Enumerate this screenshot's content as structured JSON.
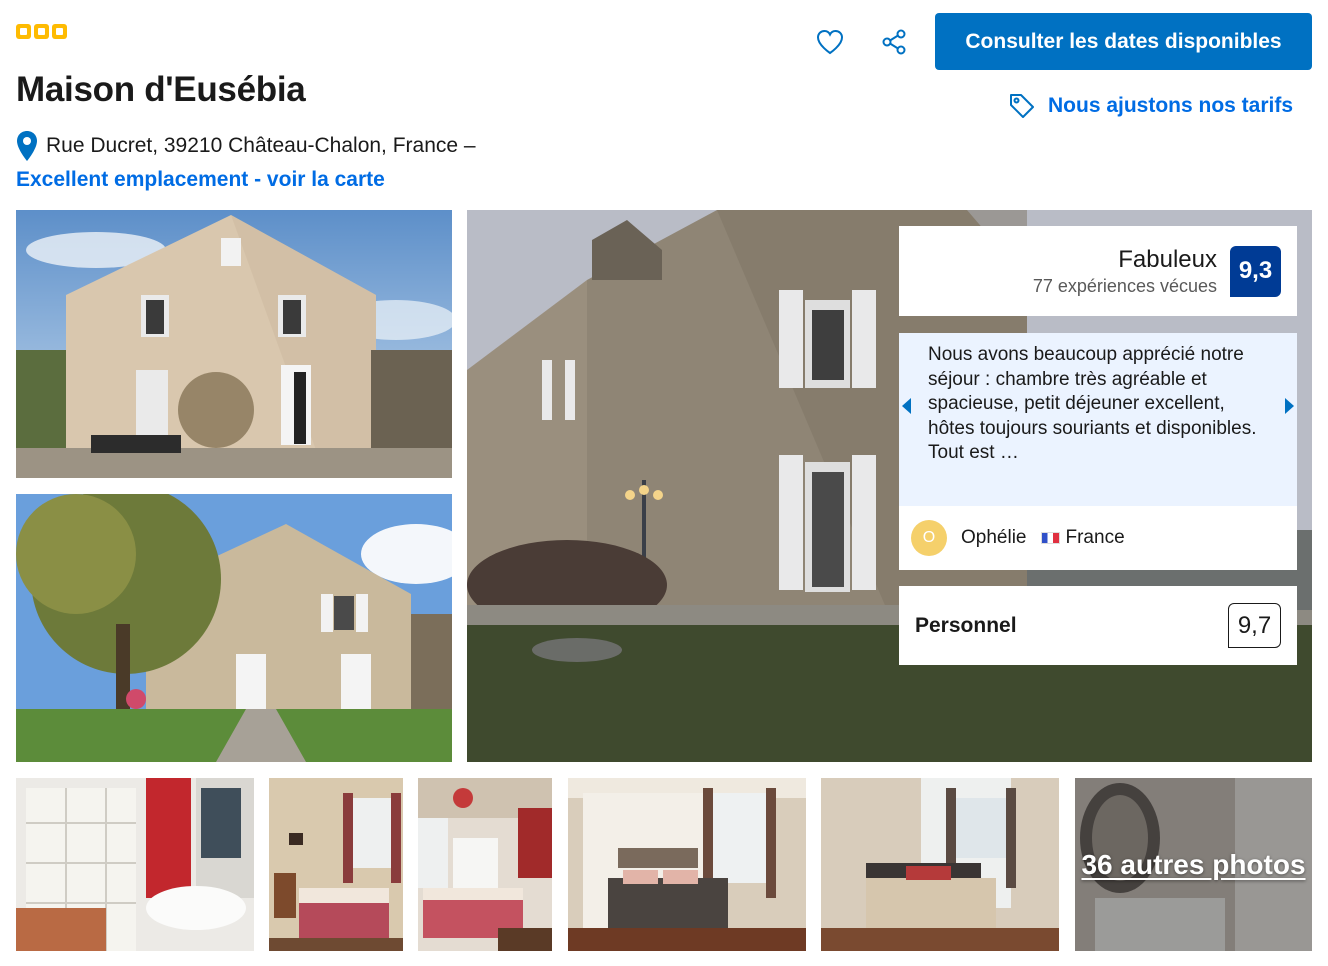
{
  "property": {
    "star_rating": 3,
    "name": "Maison d'Eusébia",
    "address": "Rue Ducret, 39210 Château-Chalon, France –",
    "map_link": "Excellent emplacement - voir la carte"
  },
  "header": {
    "cta_label": "Consulter les dates disponibles",
    "price_match_label": "Nous ajustons nos tarifs"
  },
  "rating": {
    "label": "Fabuleux",
    "reviews_count": "77 expériences vécues",
    "score": "9,3"
  },
  "review": {
    "quote": "Nous avons beaucoup apprécié notre séjour : chambre très agréable et spacieuse, petit déjeuner excellent, hôtes toujours souriants et disponibles. Tout est …",
    "author": "Ophélie",
    "author_initial": "O",
    "country": "France"
  },
  "subscore": {
    "label": "Personnel",
    "score": "9,7"
  },
  "gallery": {
    "more_photos": "36 autres photos"
  },
  "colors": {
    "brand_blue": "#0071c2",
    "link_blue": "#006ce4",
    "score_navy": "#003b95",
    "star_yellow": "#febb02",
    "review_bg": "#ebf3ff"
  }
}
